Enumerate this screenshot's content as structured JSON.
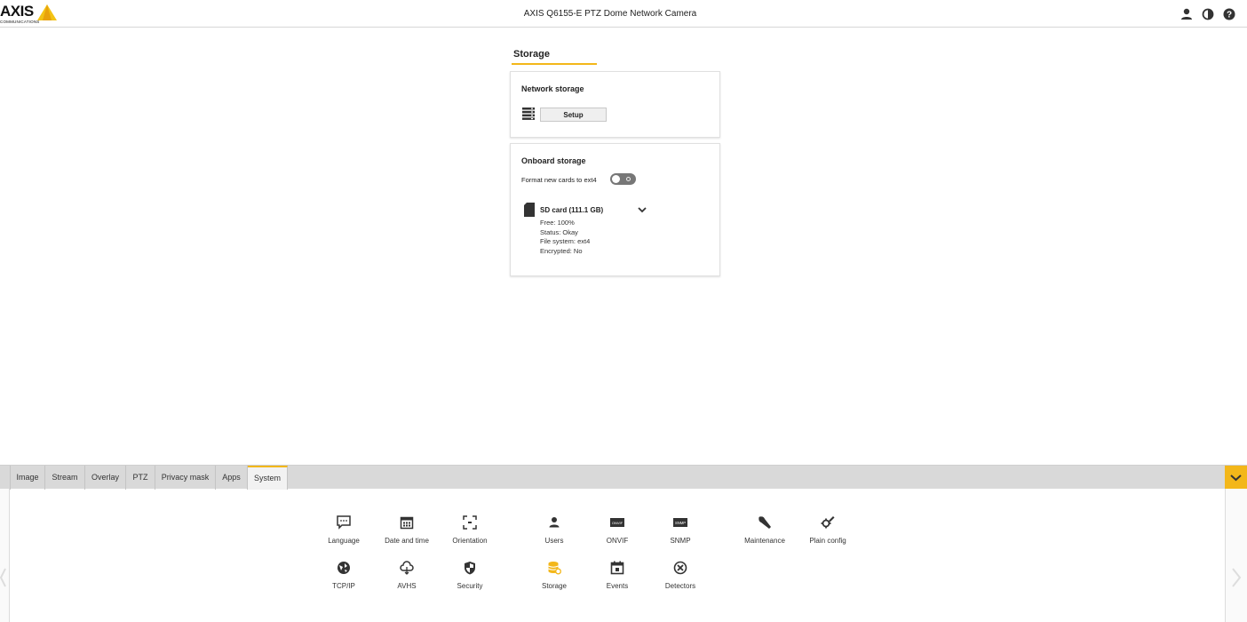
{
  "header": {
    "logo_text": "AXIS",
    "logo_sub": "COMMUNICATIONS",
    "title": "AXIS Q6155-E PTZ Dome Network Camera",
    "icons": [
      "user-icon",
      "contrast-icon",
      "help-icon"
    ]
  },
  "storage": {
    "title": "Storage",
    "network": {
      "title": "Network storage",
      "setup_label": "Setup"
    },
    "onboard": {
      "title": "Onboard storage",
      "format_label": "Format new cards to ext4",
      "sd_title": "SD card (111.1 GB)",
      "free": "Free: 100%",
      "status": "Status: Okay",
      "filesystem": "File system: ext4",
      "encrypted": "Encrypted: No"
    }
  },
  "tabs": [
    "Image",
    "Stream",
    "Overlay",
    "PTZ",
    "Privacy mask",
    "Apps",
    "System"
  ],
  "active_tab": "System",
  "system_items": {
    "language": "Language",
    "datetime": "Date and time",
    "orientation": "Orientation",
    "users": "Users",
    "onvif": "ONVIF",
    "snmp": "SNMP",
    "maintenance": "Maintenance",
    "plainconfig": "Plain config",
    "tcpip": "TCP/IP",
    "avhs": "AVHS",
    "security": "Security",
    "storage": "Storage",
    "events": "Events",
    "detectors": "Detectors"
  },
  "colors": {
    "accent": "#f3b71a",
    "tabbar": "#d9d9d9"
  }
}
